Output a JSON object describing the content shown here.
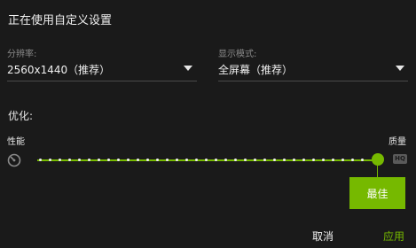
{
  "title": "正在使用自定义设置",
  "resolution": {
    "label": "分辨率:",
    "value": "2560x1440（推荐）"
  },
  "display_mode": {
    "label": "显示模式:",
    "value": "全屏幕（推荐）"
  },
  "optimize": {
    "label": "优化:",
    "left_label": "性能",
    "right_label": "质量",
    "left_icon": "gauge-icon",
    "right_icon": "hq-icon",
    "right_icon_text": "HQ",
    "slider_value": 1.0,
    "tooltip": "最佳"
  },
  "buttons": {
    "cancel": "取消",
    "apply": "应用"
  },
  "colors": {
    "accent": "#76b900",
    "background": "#1a1a1a"
  }
}
